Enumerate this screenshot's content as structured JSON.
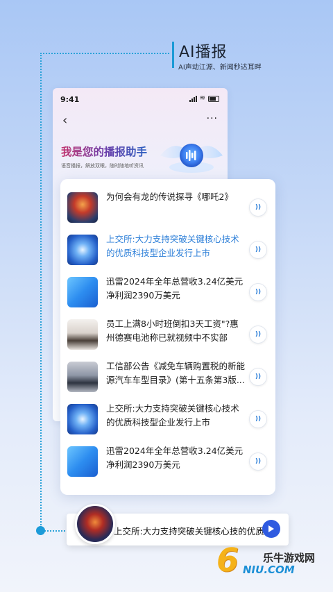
{
  "header": {
    "title": "AI播报",
    "subtitle": "AI声动江源、新闻秒达耳畔"
  },
  "phone": {
    "status_time": "9:41",
    "back_icon": "chevron-left-icon",
    "more_label": "···",
    "assistant_title": "我是您的播报助手",
    "assistant_subtitle": "语音播报，解放双眼，随时随地听资讯"
  },
  "news": [
    {
      "title": "为何会有龙的传说探寻《哪吒2》",
      "highlighted": false,
      "thumb": "nezha"
    },
    {
      "title": "上交所:大力支持突破关键核心技术的优质科技型企业发行上市",
      "highlighted": true,
      "thumb": "tech"
    },
    {
      "title": "迅雷2024年全年总营收3.24亿美元净利润2390万美元",
      "highlighted": false,
      "thumb": "xunlei"
    },
    {
      "title": "员工上满8小时班倒扣3天工资\"?惠州德赛电池称已就视频中不实部",
      "highlighted": false,
      "thumb": "office"
    },
    {
      "title": "工信部公告《减免车辆购置税的新能源汽车车型目录》(第十五条第3版...",
      "highlighted": false,
      "thumb": "car"
    },
    {
      "title": "上交所:大力支持突破关键核心技术的优质科技型企业发行上市",
      "highlighted": false,
      "thumb": "tech"
    },
    {
      "title": "迅雷2024年全年总营收3.24亿美元净利润2390万美元",
      "highlighted": false,
      "thumb": "xunlei"
    }
  ],
  "play_icon_label": "))",
  "player": {
    "title": "上交所:大力支持突破关键核心技的优质"
  },
  "watermark": {
    "numeral": "6",
    "brand_cn": "乐牛游戏网",
    "brand_en": "NIU.COM"
  },
  "colors": {
    "accent": "#2d7fd8",
    "player_button": "#2f5be0",
    "dotted_line": "#2aa2d8"
  }
}
